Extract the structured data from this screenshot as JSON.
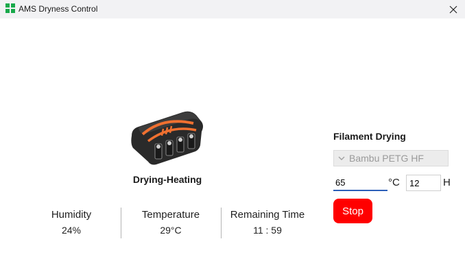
{
  "window": {
    "title": "AMS Dryness Control",
    "app_icon": "ams-app-icon",
    "close_icon": "close-icon"
  },
  "status": {
    "label": "Drying-Heating",
    "device_icon": "ams-heater-icon"
  },
  "stats": {
    "humidity": {
      "label": "Humidity",
      "value": "24%"
    },
    "temperature": {
      "label": "Temperature",
      "value": "29°C"
    },
    "remaining_time": {
      "label": "Remaining Time",
      "value": "11 : 59"
    }
  },
  "drying": {
    "title": "Filament Drying",
    "filament": "Bambu PETG HF",
    "temperature_value": "65",
    "temperature_unit": "°C",
    "hours_value": "12",
    "hours_unit": "H",
    "stop_label": "Stop"
  },
  "colors": {
    "accent_red": "#ff0000",
    "brand_green": "#19a94b",
    "heating_orange": "#f07030",
    "focus_blue": "#2b5fb8"
  }
}
